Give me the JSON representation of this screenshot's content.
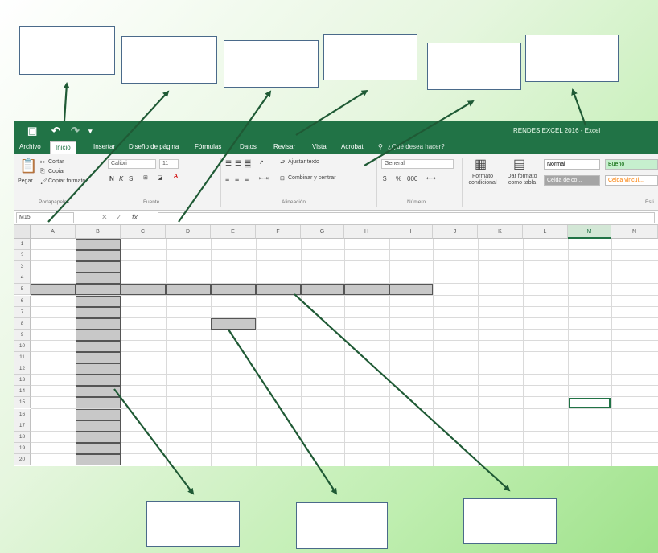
{
  "title_bar": {
    "save_icon": "save-icon",
    "undo_icon": "undo-icon",
    "redo_icon": "redo-icon",
    "doc_title": "RENDES EXCEL 2016 - Excel"
  },
  "tabs": [
    "Archivo",
    "Inicio",
    "Insertar",
    "Diseño de página",
    "Fórmulas",
    "Datos",
    "Revisar",
    "Vista",
    "Acrobat",
    "¿Qué desea hacer?"
  ],
  "active_tab": "Inicio",
  "ribbon": {
    "clipboard": {
      "paste": "Pegar",
      "cut": "Cortar",
      "copy": "Copiar",
      "format_painter": "Copiar formato",
      "label": "Portapapeles"
    },
    "font": {
      "name": "Calibri",
      "size": "11",
      "bold": "N",
      "italic": "K",
      "underline": "S",
      "label": "Fuente"
    },
    "alignment": {
      "wrap": "Ajustar texto",
      "merge": "Combinar y centrar",
      "label": "Alineación"
    },
    "number": {
      "format": "General",
      "currency": "$",
      "percent": "%",
      "thousands": "000",
      "label": "Número"
    },
    "styles": {
      "conditional": "Formato condicional",
      "as_table": "Dar formato como tabla",
      "normal": "Normal",
      "good": "Bueno",
      "check_cell": "Celda de co...",
      "linked_cell": "Celda vincul...",
      "label": "Esti"
    }
  },
  "formula_bar": {
    "name_box": "M15",
    "fx": "fx"
  },
  "columns": [
    "A",
    "B",
    "C",
    "D",
    "E",
    "F",
    "G",
    "H",
    "I",
    "J",
    "K",
    "L",
    "M",
    "N"
  ],
  "selected_column": "M",
  "rows": [
    "1",
    "2",
    "3",
    "4",
    "5",
    "6",
    "7",
    "8",
    "9",
    "10",
    "11",
    "12",
    "13",
    "14",
    "15",
    "16",
    "17",
    "18",
    "19",
    "20"
  ],
  "selected_cell": "M15",
  "colors": {
    "excel_green": "#217346",
    "shade": "#c8c8c8",
    "arrow": "#1f5a35"
  }
}
